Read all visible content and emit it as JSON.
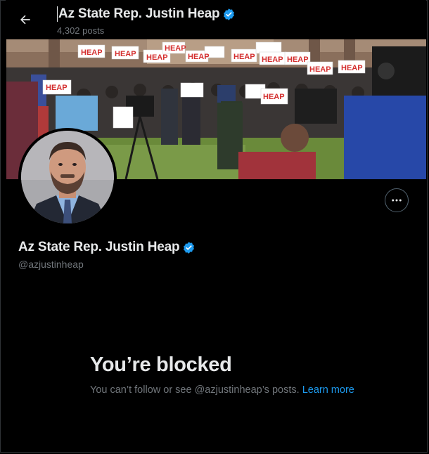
{
  "header": {
    "title": "Az State Rep. Justin Heap",
    "post_count": "4,302 posts"
  },
  "profile": {
    "display_name": "Az State Rep. Justin Heap",
    "handle": "@azjustinheap",
    "verified": true
  },
  "banner": {
    "signs": [
      "HEAP",
      "HEAP",
      "HEAP",
      "HEAP",
      "HEAP",
      "HEAP",
      "HEAP",
      "HEAP",
      "HEAP",
      "HEAP",
      "HEAP",
      "HEAP"
    ]
  },
  "blocked": {
    "title": "You’re blocked",
    "message": "You can’t follow or see @azjustinheap’s posts.",
    "learn_more": "Learn more"
  },
  "colors": {
    "background": "#000000",
    "text_primary": "#e7e9ea",
    "text_secondary": "#71767b",
    "accent": "#1d9bf0",
    "border": "#2f3336"
  },
  "icons": {
    "back": "arrow-left-icon",
    "verified": "verified-badge-icon",
    "more": "more-horizontal-icon"
  }
}
